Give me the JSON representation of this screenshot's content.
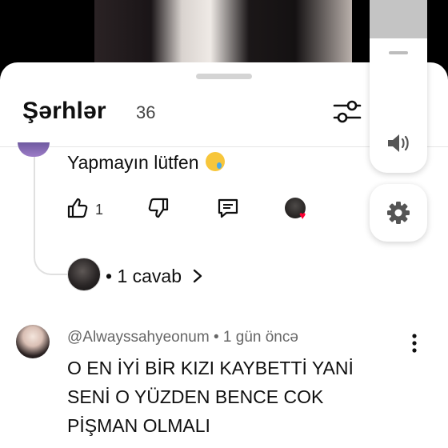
{
  "comments_sheet": {
    "title": "Şərhlər",
    "count": "36"
  },
  "comments": [
    {
      "text": "Yapmayın lütfen",
      "likes": "1",
      "reply_link": "• 1 cavab"
    },
    {
      "author": "@Alwayssahyeonum",
      "time": "• 1 gün öncə",
      "text": "O EN İYİ BİR KIZI KAYBETTİ YANİ SENİ O YÜZDEN BENCE COK PİŞMAN OLMALI"
    }
  ],
  "colors": {
    "heart": "#ff0033",
    "divider": "#e5e5e5"
  },
  "icons": [
    "filter-icon",
    "like-icon",
    "dislike-icon",
    "reply-icon",
    "chevron-right-icon",
    "more-vert-icon",
    "volume-icon",
    "gear-icon"
  ]
}
